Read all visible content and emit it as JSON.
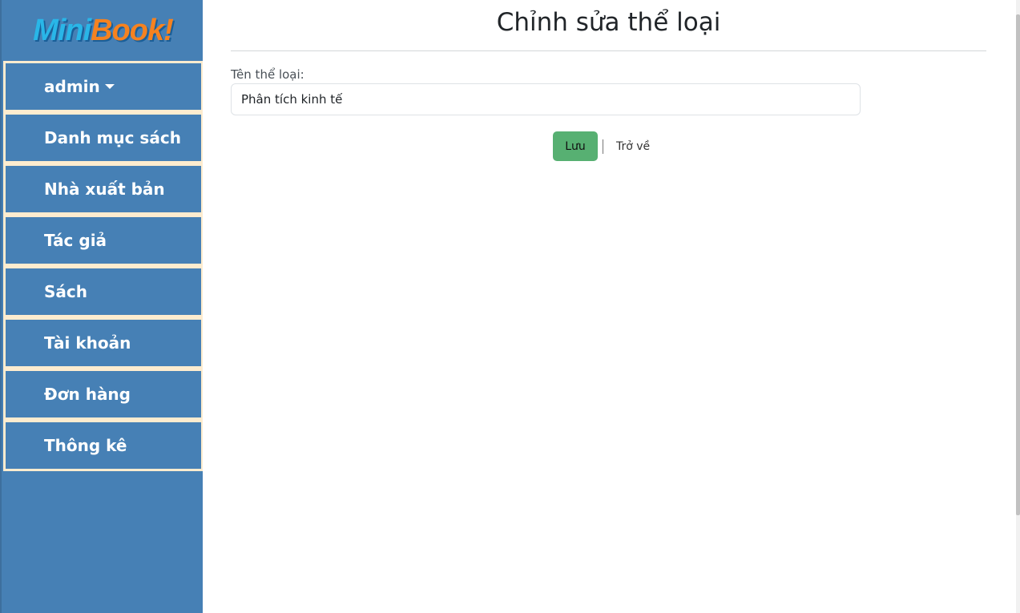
{
  "logo": {
    "part1": "Mini",
    "part2": "Book!"
  },
  "sidebar": {
    "items": [
      {
        "label": "admin"
      },
      {
        "label": "Danh mục sách"
      },
      {
        "label": "Nhà xuất bản"
      },
      {
        "label": "Tác giả"
      },
      {
        "label": "Sách"
      },
      {
        "label": "Tài khoản"
      },
      {
        "label": "Đơn hàng"
      },
      {
        "label": "Thông kê"
      }
    ]
  },
  "main": {
    "title": "Chỉnh sửa thể loại",
    "field_label": "Tên thể loại:",
    "field_value": "Phân tích kinh tế",
    "save_label": "Lưu",
    "back_label": "Trở về"
  },
  "colors": {
    "sidebar": "#4680b5",
    "menu_border": "#fdeccf",
    "save_button": "#57b072"
  }
}
